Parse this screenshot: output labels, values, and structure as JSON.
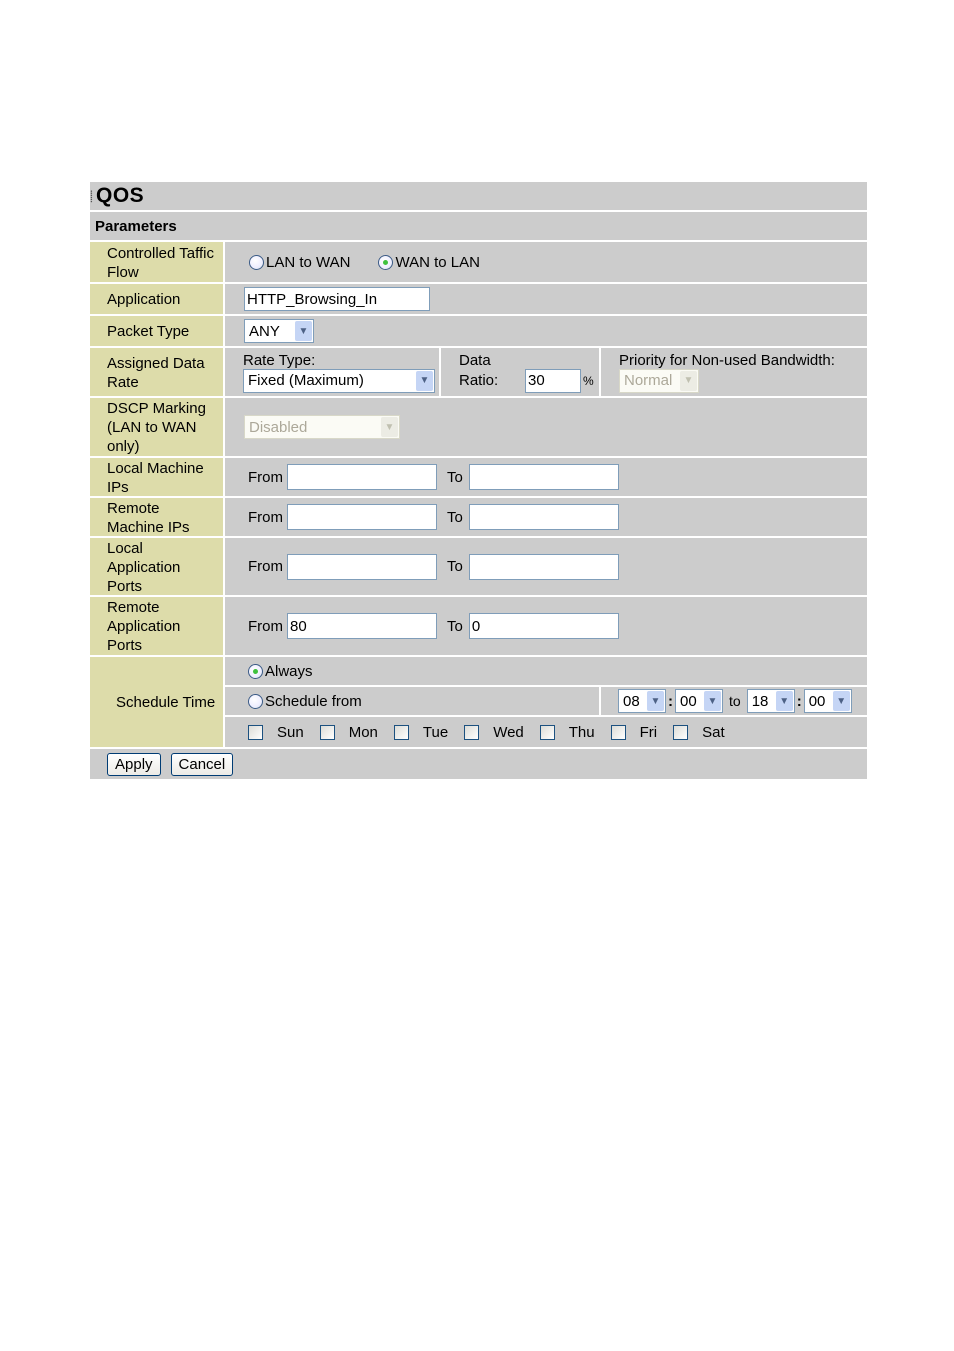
{
  "header": {
    "title": "QOS",
    "section": "Parameters"
  },
  "rows": {
    "flow": {
      "label": "Controlled Taffic Flow",
      "options": [
        "LAN to WAN",
        "WAN to LAN"
      ],
      "selected": "WAN to LAN"
    },
    "application": {
      "label": "Application",
      "value": "HTTP_Browsing_In"
    },
    "packet_type": {
      "label": "Packet Type",
      "value": "ANY"
    },
    "data_rate": {
      "label": "Assigned Data Rate",
      "rate_type_label": "Rate Type:",
      "rate_type_value": "Fixed (Maximum)",
      "data_label": "Data",
      "ratio_label": "Ratio:",
      "ratio_value": "30",
      "ratio_unit": "%",
      "priority_label": "Priority for Non-used Bandwidth:",
      "priority_value": "Normal"
    },
    "dscp": {
      "label": "DSCP Marking (LAN to WAN only)",
      "value": "Disabled"
    },
    "local_ips": {
      "label": "Local Machine IPs",
      "from_label": "From",
      "to_label": "To",
      "from": "",
      "to": ""
    },
    "remote_ips": {
      "label": "Remote Machine IPs",
      "from_label": "From",
      "to_label": "To",
      "from": "",
      "to": ""
    },
    "local_ports": {
      "label": "Local Application Ports",
      "from_label": "From",
      "to_label": "To",
      "from": "",
      "to": ""
    },
    "remote_ports": {
      "label": "Remote Application Ports",
      "from_label": "From",
      "to_label": "To",
      "from": "80",
      "to": "0"
    },
    "schedule": {
      "label": "Schedule Time",
      "always_label": "Always",
      "schedule_from_label": "Schedule from",
      "selected": "Always",
      "start_hour": "08",
      "start_min": "00",
      "to_label": "to",
      "end_hour": "18",
      "end_min": "00",
      "colon": ":",
      "days": [
        "Sun",
        "Mon",
        "Tue",
        "Wed",
        "Thu",
        "Fri",
        "Sat"
      ]
    }
  },
  "buttons": {
    "apply": "Apply",
    "cancel": "Cancel"
  }
}
